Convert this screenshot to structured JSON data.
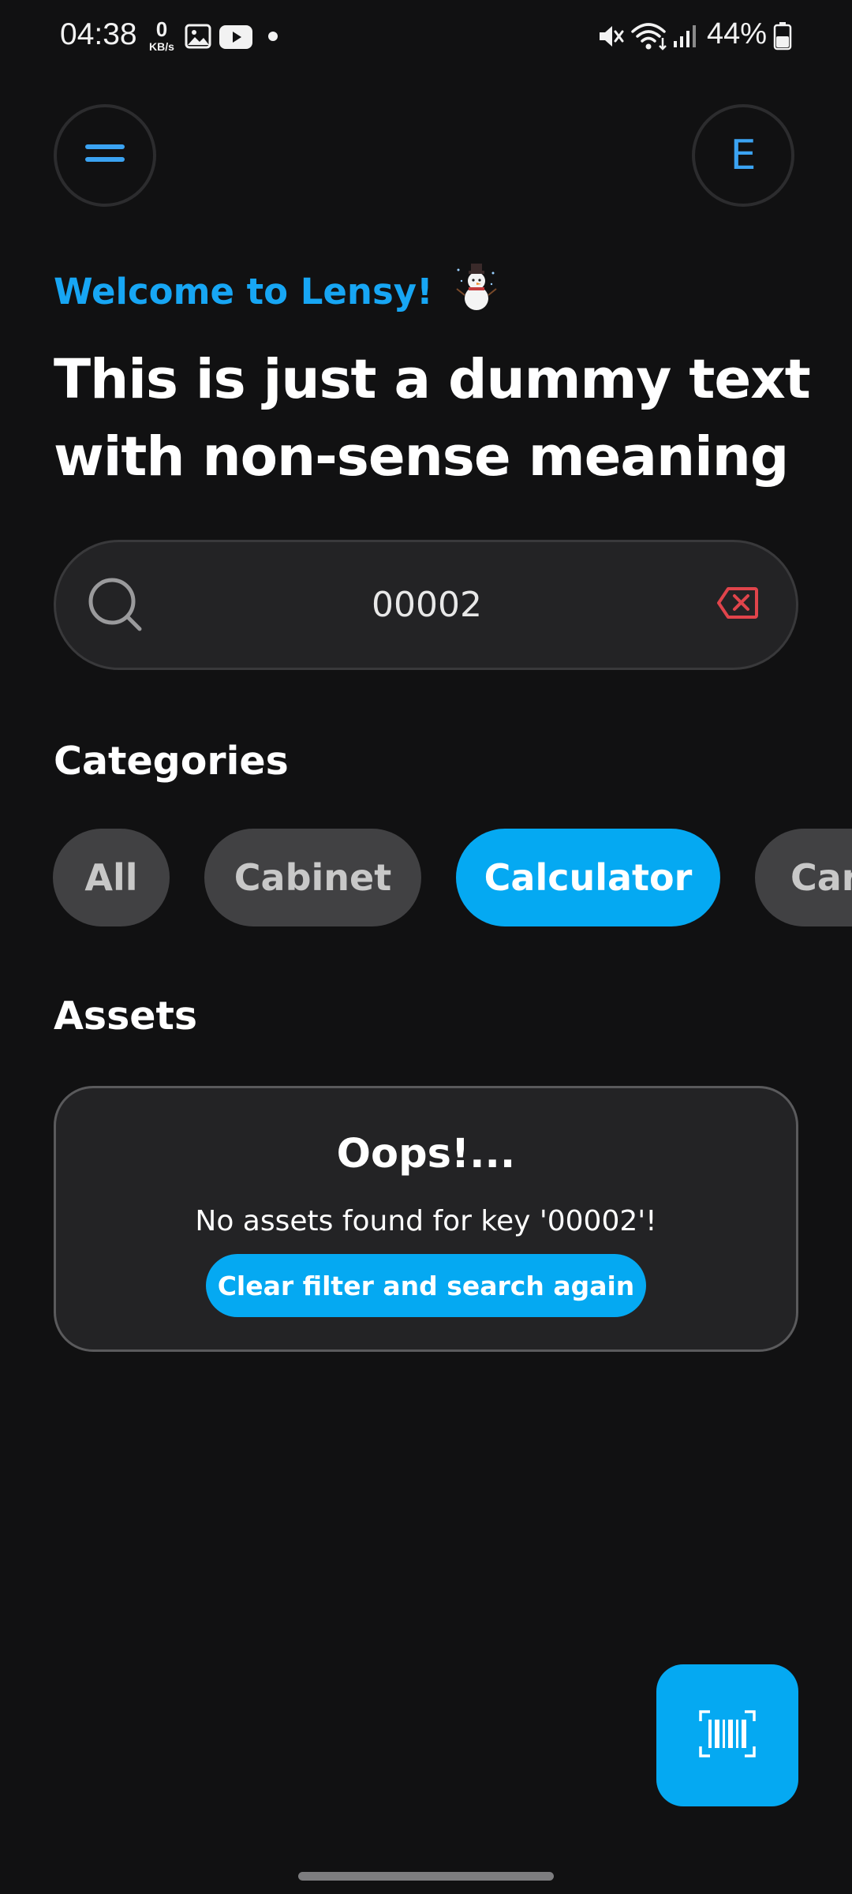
{
  "status_bar": {
    "time": "04:38",
    "net_speed_value": "0",
    "net_speed_unit": "KB/s",
    "battery_percent": "44%",
    "icons": [
      "gallery-icon",
      "youtube-icon",
      "notification-dot",
      "mute-icon",
      "wifi-icon",
      "signal-icon",
      "battery-icon"
    ]
  },
  "header": {
    "menu_icon": "hamburger-menu-icon",
    "avatar_letter": "E",
    "accent_color": "#3ba3f2"
  },
  "welcome": {
    "text": "Welcome to Lensy!",
    "emoji_icon": "snowman-icon"
  },
  "headline": "This is just a dummy text with non-sense meaning",
  "search": {
    "value": "00002",
    "icon": "search-icon",
    "clear_icon": "clear-backspace-icon",
    "clear_color": "#e0444b"
  },
  "categories": {
    "title": "Categories",
    "items": [
      {
        "label": "All",
        "active": false
      },
      {
        "label": "Cabinet",
        "active": false
      },
      {
        "label": "Calculator",
        "active": true
      },
      {
        "label": "Car",
        "active": false
      }
    ],
    "active_color": "#05a9f2"
  },
  "assets": {
    "title": "Assets",
    "empty": {
      "title": "Oops!...",
      "message": "No assets found for key '00002'!",
      "action_label": "Clear filter and search again"
    }
  },
  "fab": {
    "icon": "barcode-scan-icon"
  }
}
